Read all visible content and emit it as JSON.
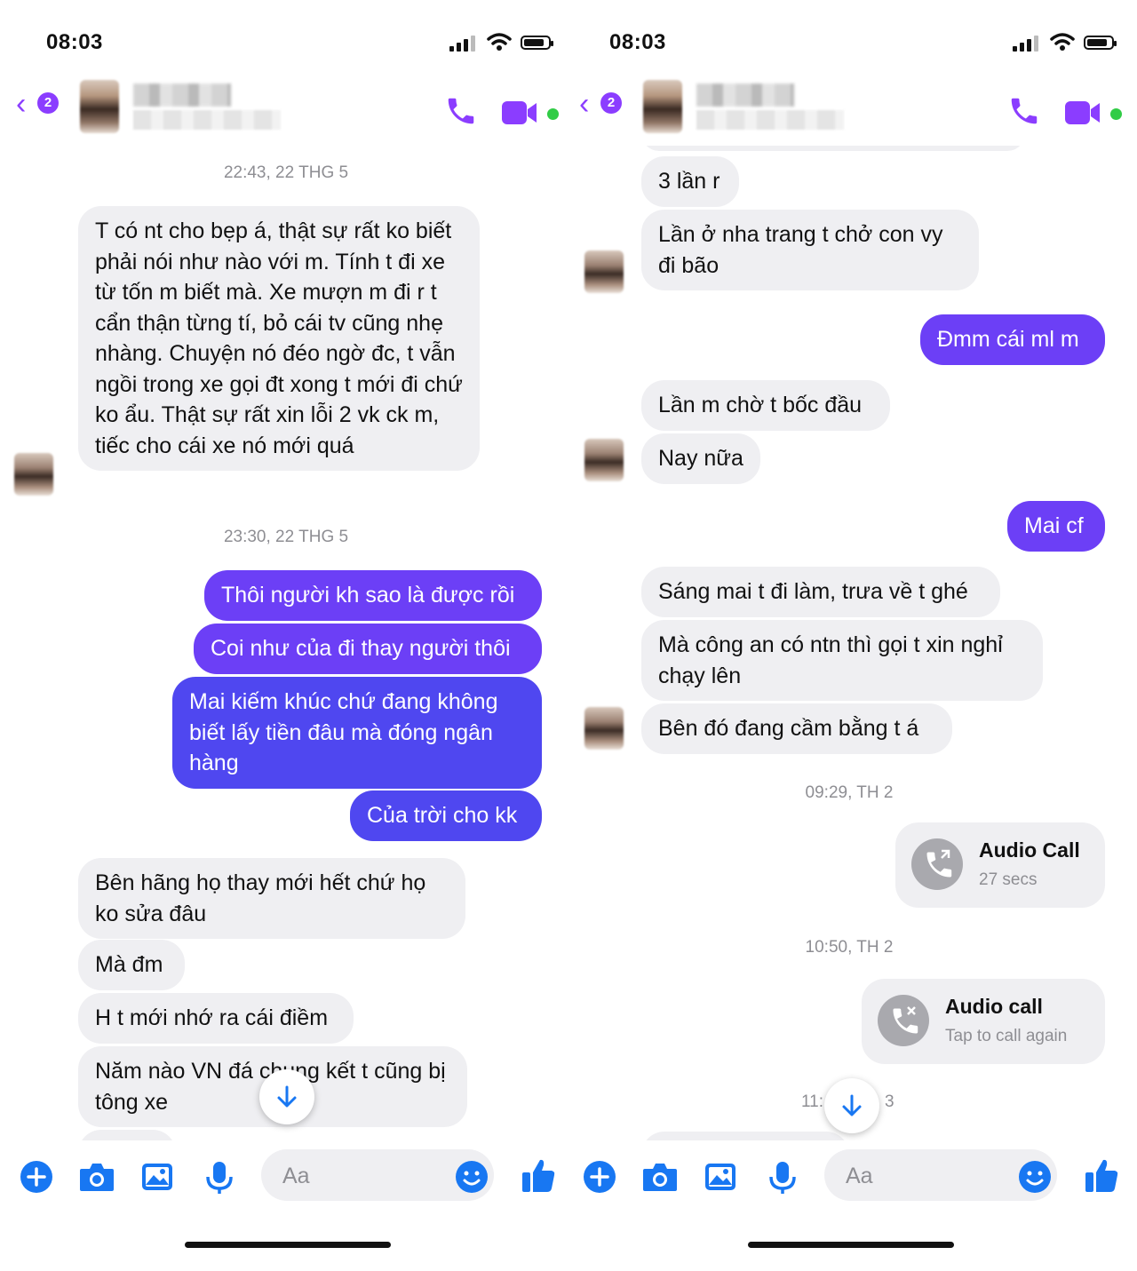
{
  "colors": {
    "accent": "#8b3dff",
    "bubble_outgoing": "#6c3ff6",
    "bubble_incoming": "#efeff2",
    "online": "#31cc46"
  },
  "status_bar": {
    "time": "08:03"
  },
  "header": {
    "unread_badge": "2"
  },
  "left": {
    "timestamps": [
      "22:43, 22 THG 5",
      "23:30, 22 THG 5"
    ],
    "messages": [
      "T có nt cho bẹp á, thật sự rất ko biết phải nói như nào với m. Tính t đi xe từ tốn m biết mà. Xe mượn m đi r t cẩn thận từng tí, bỏ cái tv cũng nhẹ nhàng. Chuyện nó đéo ngờ đc, t vẫn ngồi trong xe gọi đt xong t mới đi chứ ko ẩu. Thật sự rất xin lỗi 2 vk ck m, tiếc cho cái xe nó mới quá",
      "Thôi người kh sao là được rồi",
      "Coi như của đi thay người thôi",
      "Mai kiếm khúc chứ đang không biết lấy tiền đâu mà đóng ngân hàng",
      "Của trời cho kk",
      "Bên hãng họ thay mới hết chứ họ ko sửa đâu",
      "Mà đm",
      "H t mới nhớ ra cái điềm",
      "Năm nào VN đá chung kết t cũng bị tông xe",
      "3 lần r"
    ]
  },
  "right": {
    "messages": [
      "3 lần r",
      "Lần ở nha trang t chở con vy đi bão",
      "Đmm cái ml m",
      "Lần m chờ t bốc đầu",
      "Nay nữa",
      "Mai cf",
      "Sáng mai t đi làm, trưa về t ghé",
      "Mà công an có ntn thì gọi t xin nghỉ chạy lên",
      "Bên đó đang cầm bằng t á"
    ],
    "timestamps": [
      "09:29, TH 2",
      "10:50, TH 2",
      "11:",
      "3"
    ],
    "calls": [
      {
        "title": "Audio Call",
        "subtitle": "27 secs"
      },
      {
        "title": "Audio call",
        "subtitle": "Tap to call again"
      }
    ]
  },
  "composer": {
    "placeholder": "Aa"
  },
  "icons": [
    "back-chevron-icon",
    "phone-icon",
    "video-icon",
    "plus-icon",
    "camera-icon",
    "image-icon",
    "mic-icon",
    "emoji-icon",
    "like-icon",
    "scroll-down-icon",
    "call-icon",
    "missed-call-icon"
  ]
}
